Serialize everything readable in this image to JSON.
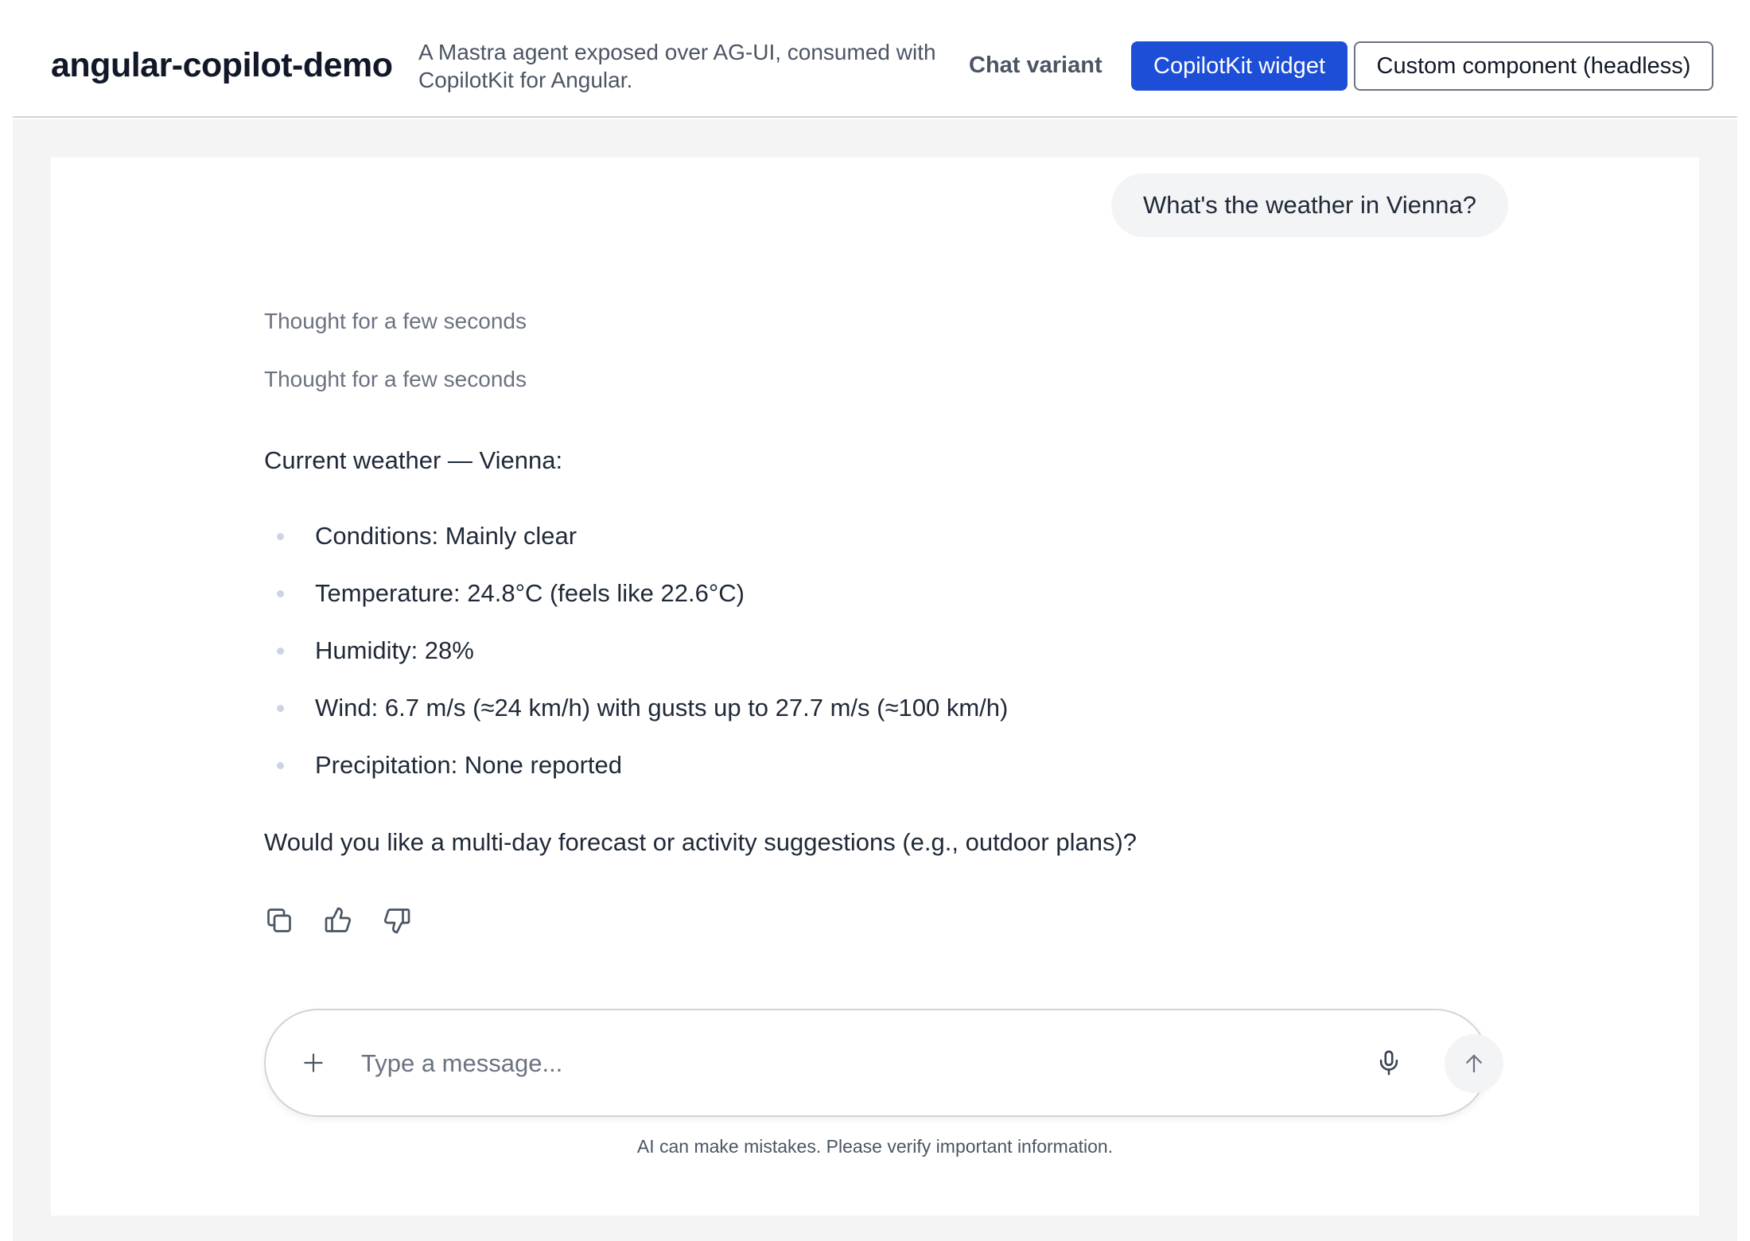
{
  "header": {
    "title": "angular-copilot-demo",
    "subtitle": "A Mastra agent exposed over AG-UI, consumed with CopilotKit for Angular.",
    "variant_label": "Chat variant",
    "variants": [
      {
        "label": "CopilotKit widget",
        "active": true
      },
      {
        "label": "Custom component (headless)",
        "active": false
      }
    ]
  },
  "chat": {
    "user_message": "What's the weather in Vienna?",
    "thoughts": [
      "Thought for a few seconds",
      "Thought for a few seconds"
    ],
    "assistant": {
      "intro": "Current weather — Vienna:",
      "bullets": [
        "Conditions: Mainly clear",
        "Temperature: 24.8°C (feels like 22.6°C)",
        "Humidity: 28%",
        "Wind: 6.7 m/s (≈24 km/h) with gusts up to 27.7 m/s (≈100 km/h)",
        "Precipitation: None reported"
      ],
      "followup": "Would you like a multi-day forecast or activity suggestions (e.g., outdoor plans)?"
    },
    "actions": [
      "copy-icon",
      "thumbs-up-icon",
      "thumbs-down-icon"
    ]
  },
  "composer": {
    "placeholder": "Type a message...",
    "value": "",
    "icons": [
      "plus-icon",
      "microphone-icon",
      "arrow-up-icon"
    ]
  },
  "disclaimer": "AI can make mistakes. Please verify important information.",
  "colors": {
    "accent": "#1d4ed8",
    "page_bg": "#f4f4f4",
    "bubble_bg": "#f3f4f6"
  }
}
